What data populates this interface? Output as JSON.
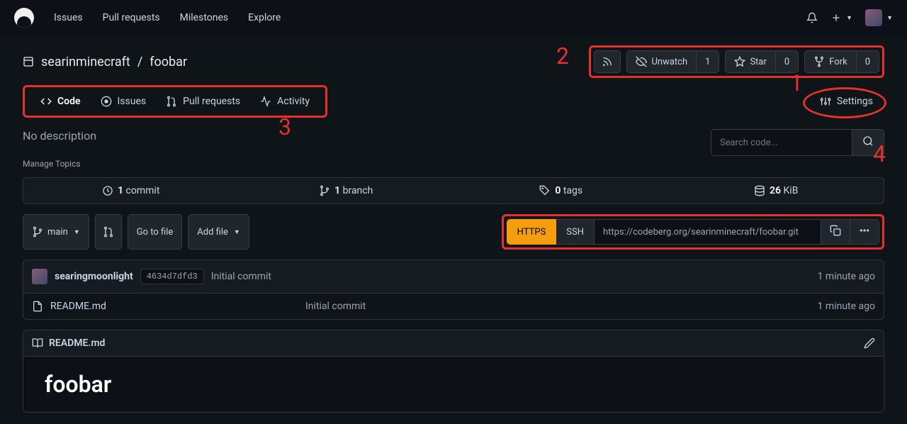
{
  "nav": {
    "issues": "Issues",
    "pulls": "Pull requests",
    "milestones": "Milestones",
    "explore": "Explore"
  },
  "repo": {
    "owner": "searinminecraft",
    "name": "foobar"
  },
  "actions": {
    "unwatch": "Unwatch",
    "unwatch_count": "1",
    "star": "Star",
    "star_count": "0",
    "fork": "Fork",
    "fork_count": "0"
  },
  "tabs": {
    "code": "Code",
    "issues": "Issues",
    "pulls": "Pull requests",
    "activity": "Activity",
    "settings": "Settings"
  },
  "desc": {
    "text": "No description",
    "manage": "Manage Topics"
  },
  "search": {
    "placeholder": "Search code..."
  },
  "stats": {
    "commits": "1",
    "commits_label": " commit",
    "branches": "1",
    "branches_label": " branch",
    "tags": "0",
    "tags_label": " tags",
    "size": "26",
    "size_label": " KiB"
  },
  "toolbar": {
    "branch": "main",
    "gotofile": "Go to file",
    "addfile": "Add file"
  },
  "clone": {
    "https": "HTTPS",
    "ssh": "SSH",
    "url": "https://codeberg.org/searinminecraft/foobar.git"
  },
  "commit": {
    "author": "searingmoonlight",
    "hash": "4634d7dfd3",
    "msg": "Initial commit",
    "time": "1 minute ago"
  },
  "file": {
    "name": "README.md",
    "msg": "Initial commit",
    "time": "1 minute ago"
  },
  "readme": {
    "title": "README.md",
    "heading": "foobar"
  },
  "annotations": {
    "a1": "1",
    "a2": "2",
    "a3": "3",
    "a4": "4"
  }
}
